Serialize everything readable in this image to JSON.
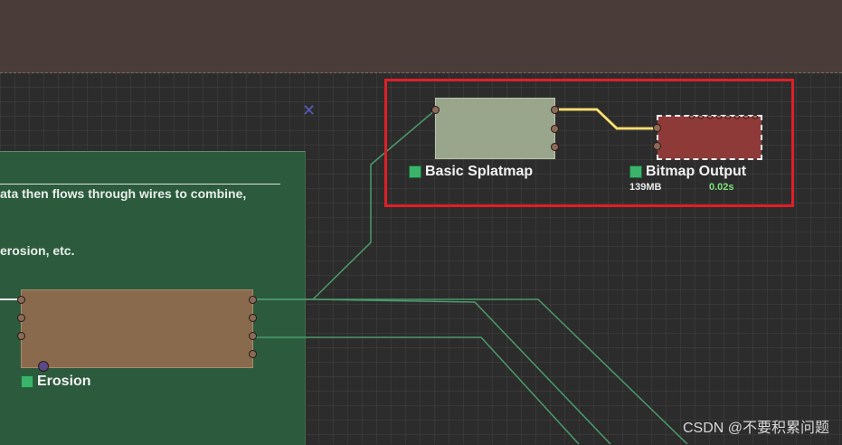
{
  "comment": {
    "line1": "ata then flows through wires to combine,",
    "line2": "erosion, etc."
  },
  "nodes": {
    "basic_splatmap": {
      "label": "Basic Splatmap"
    },
    "bitmap_output": {
      "label": "Bitmap Output",
      "memory": "139MB",
      "time": "0.02s"
    },
    "erosion": {
      "label": "Erosion"
    }
  },
  "close_mark": "✕",
  "watermark": "CSDN @不要积累问题",
  "colors": {
    "highlight": "#e01f26",
    "wire_active": "#e8c84a",
    "wire_normal": "#4c9a6c",
    "status_green": "#3bb36b",
    "time_text": "#7fe07a"
  }
}
